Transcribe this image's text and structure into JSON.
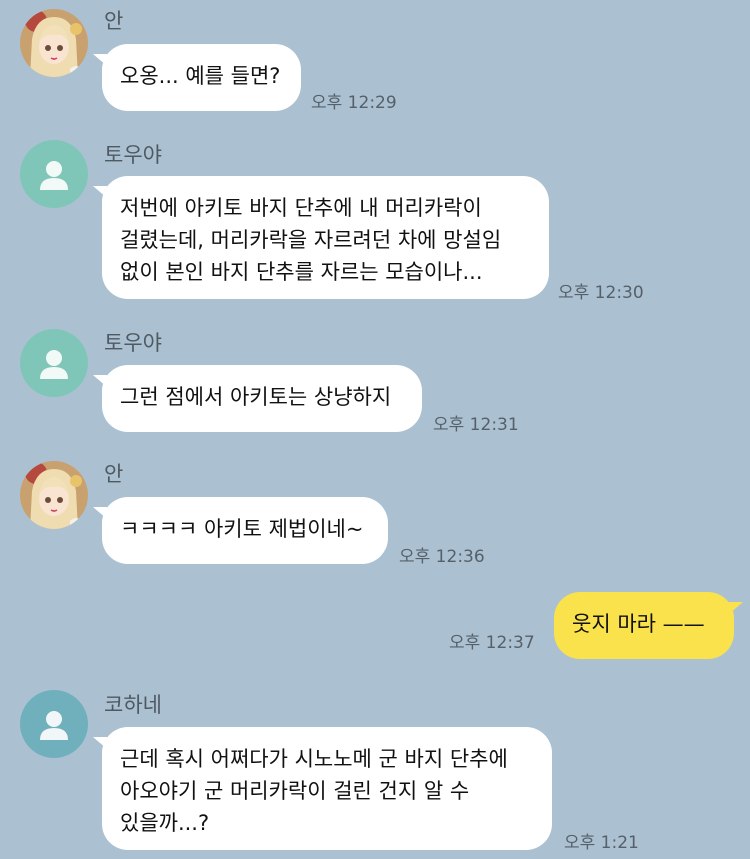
{
  "messages": [
    {
      "sender": "안",
      "text": "오옹... 예를 들면?",
      "time": "오후 12:29"
    },
    {
      "sender": "토우야",
      "text": "저번에 아키토 바지 단추에 내 머리카락이\n걸렸는데, 머리카락을 자르려던 차에 망설임\n없이 본인 바지 단추를 자르는 모습이나...",
      "time": "오후 12:30"
    },
    {
      "sender": "토우야",
      "text": "그런 점에서 아키토는 상냥하지",
      "time": "오후 12:31"
    },
    {
      "sender": "안",
      "text": "ㅋㅋㅋㅋ 아키토 제법이네~",
      "time": "오후 12:36"
    },
    {
      "text": "웃지 마라 ——",
      "time": "오후 12:37"
    },
    {
      "sender": "코하네",
      "text": "근데 혹시 어쩌다가 시노노메 군 바지 단추에\n아오야기 군 머리카락이 걸린 건지 알 수\n있을까...?",
      "time": "오후 1:21"
    }
  ],
  "colors": {
    "background": "#abc1d1",
    "incoming_bubble": "#ffffff",
    "outgoing_bubble": "#f9e24b",
    "default_avatar_towa": "#7fc6b9",
    "default_avatar_kohane": "#6fb0bc"
  },
  "icons": {
    "an_avatar": "anime-girl-avatar",
    "default_avatar": "person-silhouette-icon"
  }
}
